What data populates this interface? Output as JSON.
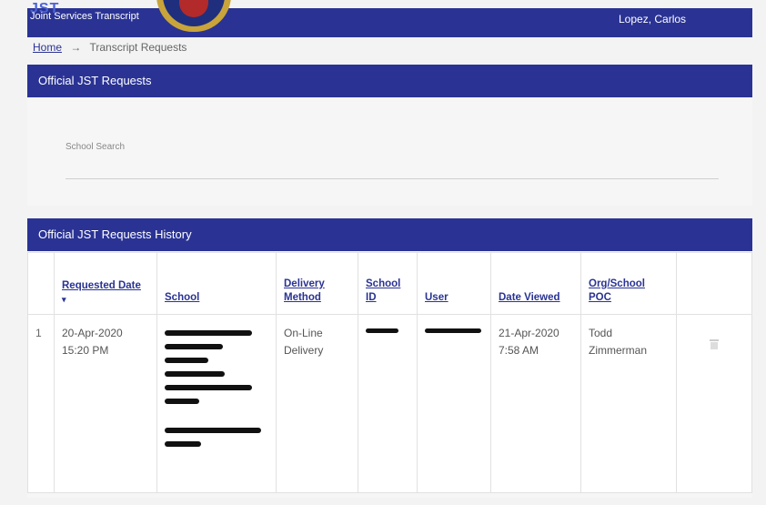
{
  "header": {
    "app_name": "Joint Services Transcript",
    "app_abbrev": "JST",
    "user_name": "Lopez, Carlos",
    "colors": {
      "brand": "#2a3394",
      "seal_gold": "#c8a43a",
      "seal_red": "#b22a2a"
    }
  },
  "breadcrumb": {
    "home": "Home",
    "separator": "→",
    "current": "Transcript Requests"
  },
  "requests_panel": {
    "title": "Official JST Requests",
    "search_label": "School Search",
    "search_value": ""
  },
  "history_panel": {
    "title": "Official JST Requests History",
    "columns": {
      "requested_date": "Requested Date",
      "sort_icon": "▾",
      "school": "School",
      "delivery_method_1": "Delivery",
      "delivery_method_2": "Method",
      "school_id_1": "School",
      "school_id_2": "ID",
      "user": "User",
      "date_viewed": "Date Viewed",
      "org_poc_1": "Org/School",
      "org_poc_2": "POC"
    },
    "rows": [
      {
        "index": "1",
        "requested_date": "20-Apr-2020",
        "requested_time": "15:20 PM",
        "delivery_1": "On-Line",
        "delivery_2": "Delivery",
        "viewed_date": "21-Apr-2020",
        "viewed_time": "7:58 AM",
        "poc_1": "Todd",
        "poc_2": "Zimmerman",
        "delete_icon": "trash-icon"
      }
    ]
  }
}
